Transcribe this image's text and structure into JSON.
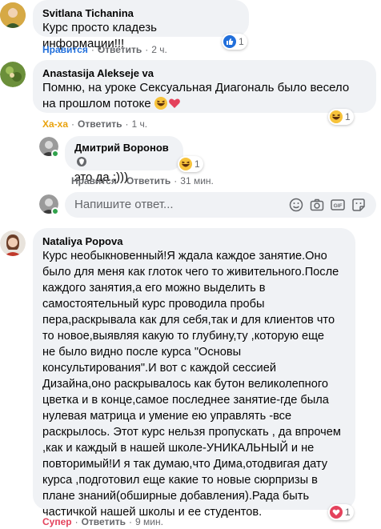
{
  "comments": [
    {
      "author": "Svitlana Tichanina",
      "text": "Курс просто кладезь информации!!!",
      "reaction_label": "Нравится",
      "reply_label": "Ответить",
      "time": "2 ч.",
      "react_count": "1"
    },
    {
      "author": "Anastasija Alekseje va",
      "text": "Помню, на уроке Сексуальная Диагональ было весело\nна прошлом потоке",
      "reaction_label": "Ха-ха",
      "reply_label": "Ответить",
      "time": "1 ч.",
      "react_count": "1"
    },
    {
      "author": "Дмитрий Воронов",
      "text": "это да :)))",
      "reaction_label": "Нравится",
      "reply_label": "Ответить",
      "time": "31 мин."
    },
    {
      "author": "Nataliya Popova",
      "text": "Курс необыкновенный!Я ждала каждое занятие.Оно\nбыло для меня как глоток чего то живительного.После\nкаждого занятия,а его можно выделить в\nсамостоятельный курс проводила пробы\nпера,раскрывала как для себя,так и для клиентов что\nто новое,выявляя какую то глубину,ту ,которую еще\nне было видно после курса \"Основы\nконсультирования\".И вот с каждой сессией\nДизайна,оно раскрывалось как бутон великолепного\nцветка и в конце,самое последнее занятие-где была\nнулевая матрица и умение ею управлять -все\nраскрылось. Этот курс нельзя пропускать , да впрочем\n,как и каждый в нашей школе-УНИКАЛЬНЫЙ и не\nповторимый!И я так думаю,что Дима,отодвигая дату\nкурса ,подготовил еще какие то новые сюрпризы в\nплане знаний(обширные добавления).Рада быть\nчастичкой нашей школы и ее студентов.",
      "reaction_label": "Супер",
      "reply_label": "Ответить",
      "time": "9 мин.",
      "react_count": "1"
    }
  ],
  "reply_input": {
    "placeholder": "Напишите ответ..."
  },
  "separator": "·",
  "colors": {
    "like_blue": "#216fdb",
    "haha_orange": "#e9a20c",
    "love_red": "#e4425c",
    "bubble_bg": "#f0f2f5",
    "secondary_text": "#65676b"
  },
  "icons": [
    "like-icon",
    "haha-icon",
    "heart-icon",
    "love-icon",
    "emoji-icon",
    "camera-icon",
    "gif-icon",
    "sticker-icon",
    "shield-badge-icon"
  ]
}
